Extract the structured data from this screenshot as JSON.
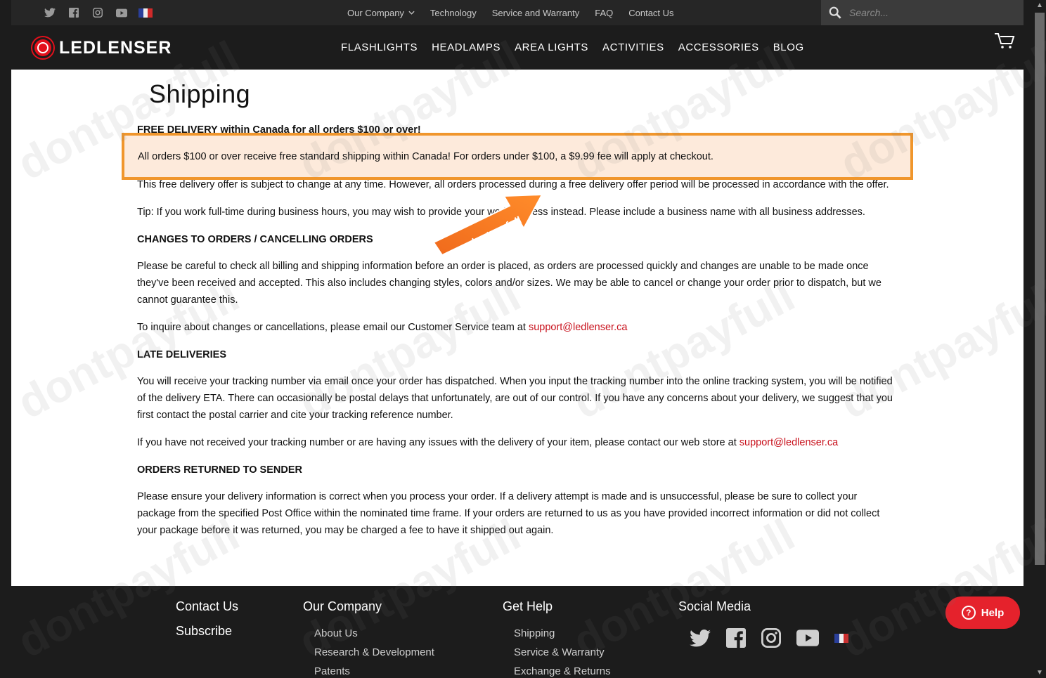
{
  "topbar": {
    "social_icons": [
      "twitter-icon",
      "facebook-icon",
      "instagram-icon",
      "youtube-icon"
    ],
    "nav": [
      {
        "label": "Our Company",
        "has_dropdown": true
      },
      {
        "label": "Technology"
      },
      {
        "label": "Service and Warranty"
      },
      {
        "label": "FAQ"
      },
      {
        "label": "Contact Us"
      }
    ],
    "search_placeholder": "Search..."
  },
  "header": {
    "brand": "LEDLENSER",
    "nav": [
      "FLASHLIGHTS",
      "HEADLAMPS",
      "AREA LIGHTS",
      "ACTIVITIES",
      "ACCESSORIES",
      "BLOG"
    ]
  },
  "page": {
    "title": "Shipping",
    "free_delivery_heading": "FREE DELIVERY within Canada for all orders $100 or over!",
    "highlight": "All orders $100 or over receive free standard shipping within Canada! For orders under $100, a $9.99 fee will apply at checkout.",
    "offer_note": "This free delivery offer is subject to change at any time. However, all orders processed during a free delivery offer period will be processed in accordance with the offer.",
    "tip": "Tip: If you work full-time during business hours, you may wish to provide your work address instead. Please include a business name with all business addresses.",
    "changes_heading": "CHANGES TO ORDERS / CANCELLING ORDERS",
    "changes_text": "Please be careful to check all billing and shipping information before an order is placed, as orders are processed quickly and changes are unable to be made once they've been received and accepted. This also includes changing styles, colors and/or sizes. We may be able to cancel or change your order prior to dispatch, but we cannot guarantee this.",
    "inquire_text": "To inquire about changes or cancellations, please email our Customer Service team at ",
    "support_email": "support@ledlenser.ca",
    "late_heading": "LATE DELIVERIES",
    "late_text": "You will receive your tracking number via email once your order has dispatched. When you input the tracking number into the online tracking system, you will be notified of the delivery ETA. There can occasionally be postal delays that unfortunately, are out of our control. If you have any concerns about your delivery, we suggest that you first contact the postal carrier and cite your tracking reference number.",
    "not_received_text": "If you have not received your tracking number or are having any issues with the delivery of your item, please contact our web store at ",
    "returned_heading": "ORDERS RETURNED TO SENDER",
    "returned_text": "Please ensure your delivery information is correct when you process your order. If a delivery attempt is made and is unsuccessful, please be sure to collect your package from the specified Post Office within the nominated time frame. If your orders are returned to us as you have provided incorrect information or did not collect your package before it was returned, you may be charged a fee to have it shipped out again."
  },
  "badge": {
    "text": "dontpayfull"
  },
  "watermark": "dontpayfull",
  "footer": {
    "contact": "Contact Us",
    "subscribe": "Subscribe",
    "company_heading": "Our Company",
    "company_links": [
      "About Us",
      "Research & Development",
      "Patents"
    ],
    "help_heading": "Get Help",
    "help_links": [
      "Shipping",
      "Service & Warranty",
      "Exchange & Returns"
    ],
    "social_heading": "Social Media",
    "help_button": "Help"
  },
  "colors": {
    "accent": "#e3101b",
    "highlight_border": "#f0962c",
    "highlight_bg": "#fdeadb",
    "link": "#c8101b"
  }
}
